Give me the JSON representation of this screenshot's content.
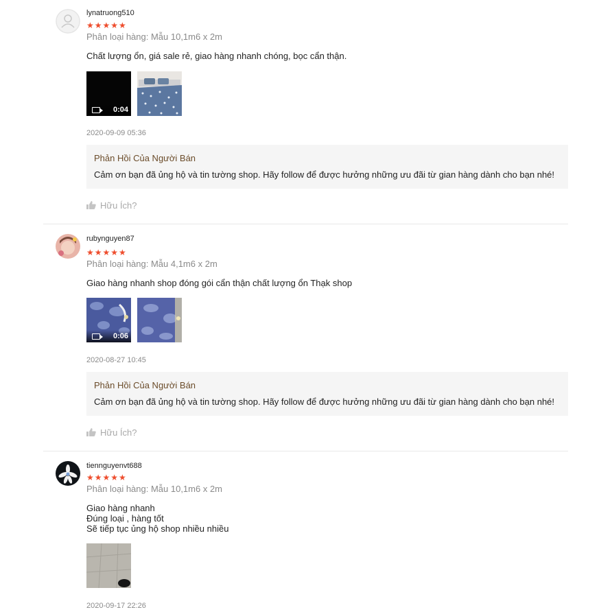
{
  "reviews": [
    {
      "username": "lynatruong510",
      "stars": "★★★★★",
      "rating": 5,
      "variant": "Phân loại hàng: Mẫu 10,1m6 x 2m",
      "content": "Chất lượng ổn, giá sale rẻ, giao hàng nhanh chóng, bọc cẩn thận.",
      "video_duration": "0:04",
      "timestamp": "2020-09-09 05:36",
      "reply_title": "Phản Hồi Của Người Bán",
      "reply_text": "Cảm ơn bạn đã ủng hộ và tin tường shop. Hãy follow để được hưởng những ưu đãi từ gian hàng dành cho bạn nhé!",
      "helpful": "Hữu Ích?"
    },
    {
      "username": "rubynguyen87",
      "stars": "★★★★★",
      "rating": 5,
      "variant": "Phân loại hàng: Mẫu 4,1m6 x 2m",
      "content": "Giao hàng nhanh shop đóng gói cẩn thận chất lượng ổn Thạk shop",
      "video_duration": "0:06",
      "timestamp": "2020-08-27 10:45",
      "reply_title": "Phản Hồi Của Người Bán",
      "reply_text": "Cảm ơn bạn đã ủng hộ và tin tường shop. Hãy follow để được hưởng những ưu đãi từ gian hàng dành cho bạn nhé!",
      "helpful": "Hữu Ích?"
    },
    {
      "username": "tiennguyenvt688",
      "stars": "★★★★★",
      "rating": 5,
      "variant": "Phân loại hàng: Mẫu 10,1m6 x 2m",
      "content": "Giao hàng nhanh\nĐúng loại , hàng tốt\nSẽ tiếp tục ủng hộ shop nhiều nhiều",
      "timestamp": "2020-09-17 22:26"
    }
  ],
  "colors": {
    "star": "#ee4d2d",
    "reply_title": "#6b4c2a",
    "muted": "#8a8a8a"
  }
}
